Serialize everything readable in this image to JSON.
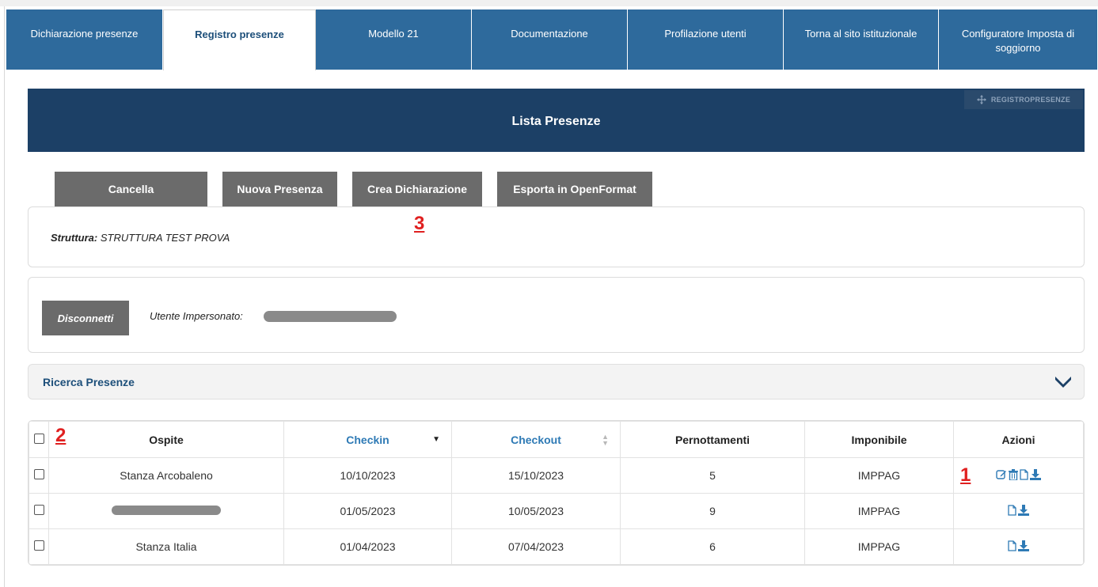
{
  "nav": {
    "tabs": [
      {
        "label": "Dichiarazione presenze"
      },
      {
        "label": "Registro presenze"
      },
      {
        "label": "Modello 21"
      },
      {
        "label": "Documentazione"
      },
      {
        "label": "Profilazione utenti"
      },
      {
        "label": "Torna al sito istituzionale"
      },
      {
        "label": "Configuratore Imposta di soggiorno"
      }
    ],
    "active_tab": "Registro presenze"
  },
  "header": {
    "title": "Lista Presenze",
    "portlet_tag": "REGISTROPRESENZE"
  },
  "toolbar": {
    "cancel_label": "Cancella",
    "new_label": "Nuova Presenza",
    "create_decl_label": "Crea Dichiarazione",
    "export_label": "Esporta in OpenFormat"
  },
  "struttura": {
    "label": "Struttura:",
    "value": "STRUTTURA TEST PROVA"
  },
  "impersonation": {
    "disconnect_label": "Disconnetti",
    "label": "Utente Impersonato:"
  },
  "search": {
    "title": "Ricerca Presenze"
  },
  "annotations": {
    "one": "1",
    "two": "2",
    "three": "3"
  },
  "table": {
    "headers": {
      "ospite": "Ospite",
      "checkin": "Checkin",
      "checkout": "Checkout",
      "pernottamenti": "Pernottamenti",
      "imponibile": "Imponibile",
      "azioni": "Azioni"
    },
    "rows": [
      {
        "ospite": "Stanza Arcobaleno",
        "checkin": "10/10/2023",
        "checkout": "15/10/2023",
        "pernottamenti": "5",
        "imponibile": "IMPPAG"
      },
      {
        "ospite": "",
        "checkin": "01/05/2023",
        "checkout": "10/05/2023",
        "pernottamenti": "9",
        "imponibile": "IMPPAG"
      },
      {
        "ospite": "Stanza Italia",
        "checkin": "01/04/2023",
        "checkout": "07/04/2023",
        "pernottamenti": "6",
        "imponibile": "IMPPAG"
      }
    ]
  },
  "colors": {
    "nav_blue": "#2e6a9c",
    "header_navy": "#1c4066",
    "button_gray": "#6b6b6b",
    "link_blue": "#2e7ab5",
    "annotation_red": "#e02020"
  }
}
